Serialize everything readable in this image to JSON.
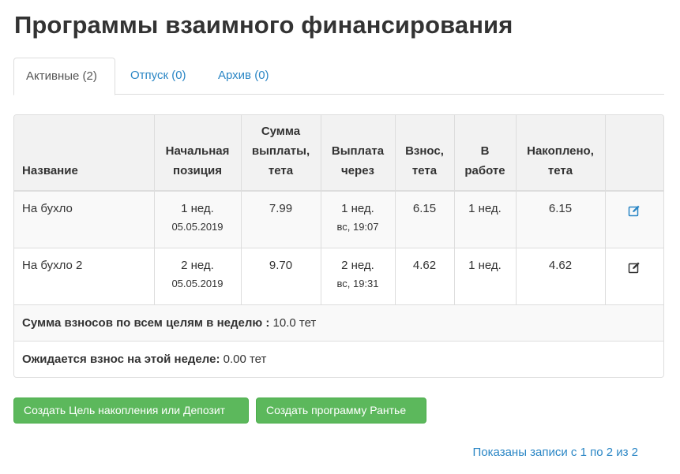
{
  "page": {
    "title": "Программы взаимного финансирования"
  },
  "tabs": [
    {
      "label": "Активные (2)",
      "active": true
    },
    {
      "label": "Отпуск (0)",
      "active": false
    },
    {
      "label": "Архив (0)",
      "active": false
    }
  ],
  "table": {
    "headers": [
      "Название",
      "Начальная позиция",
      "Сумма выплаты, тета",
      "Выплата через",
      "Взнос, тета",
      "В работе",
      "Накоплено, тета",
      ""
    ],
    "rows": [
      {
        "name": "На бухло",
        "start": "1 нед.",
        "start_date": "05.05.2019",
        "payout": "7.99",
        "payout_in": "1 нед.",
        "payout_in_time": "вс, 19:07",
        "contribution": "6.15",
        "in_work": "1 нед.",
        "saved": "6.15",
        "edit_icon": "edit-icon",
        "edit_color": "#2a86c5"
      },
      {
        "name": "На бухло 2",
        "start": "2 нед.",
        "start_date": "05.05.2019",
        "payout": "9.70",
        "payout_in": "2 нед.",
        "payout_in_time": "вс, 19:31",
        "contribution": "4.62",
        "in_work": "1 нед.",
        "saved": "4.62",
        "edit_icon": "edit-icon",
        "edit_color": "#333333"
      }
    ]
  },
  "summary": {
    "total_label": "Сумма взносов по всем целям в неделю :",
    "total_value": " 10.0 тет",
    "expected_label": "Ожидается взнос на этой неделе:",
    "expected_value": " 0.00 тет"
  },
  "buttons": {
    "create_goal": "Создать Цель накопления или Депозит",
    "create_rent": "Создать программу Рантье"
  },
  "footer": {
    "info": "Показаны записи с 1 по 2 из 2"
  },
  "colors": {
    "link": "#2a86c5",
    "success": "#5cb85c",
    "header_bg": "#f2f2f2",
    "stripe": "#f9f9f9"
  }
}
